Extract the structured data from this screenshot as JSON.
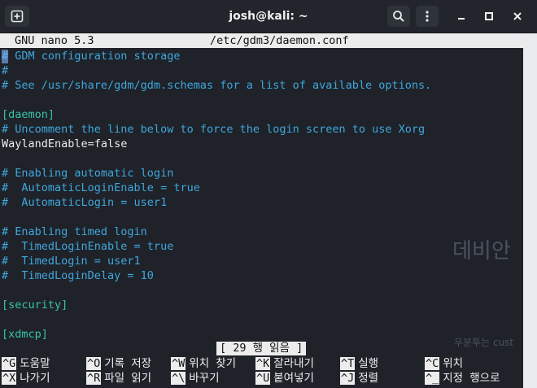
{
  "window": {
    "title": "josh@kali: ~"
  },
  "nano": {
    "version": "GNU nano 5.3",
    "filename": "/etc/gdm3/daemon.conf"
  },
  "lines": [
    {
      "text": "# GDM configuration storage",
      "kind": "comment"
    },
    {
      "text": "#",
      "kind": "comment"
    },
    {
      "text": "# See /usr/share/gdm/gdm.schemas for a list of available options.",
      "kind": "comment"
    },
    {
      "text": "",
      "kind": "text"
    },
    {
      "text": "[daemon]",
      "kind": "section"
    },
    {
      "text": "# Uncomment the line below to force the login screen to use Xorg",
      "kind": "comment"
    },
    {
      "text": "WaylandEnable=false",
      "kind": "text"
    },
    {
      "text": "",
      "kind": "text"
    },
    {
      "text": "# Enabling automatic login",
      "kind": "comment"
    },
    {
      "text": "#  AutomaticLoginEnable = true",
      "kind": "comment"
    },
    {
      "text": "#  AutomaticLogin = user1",
      "kind": "comment"
    },
    {
      "text": "",
      "kind": "text"
    },
    {
      "text": "# Enabling timed login",
      "kind": "comment"
    },
    {
      "text": "#  TimedLoginEnable = true",
      "kind": "comment"
    },
    {
      "text": "#  TimedLogin = user1",
      "kind": "comment"
    },
    {
      "text": "#  TimedLoginDelay = 10",
      "kind": "comment"
    },
    {
      "text": "",
      "kind": "text"
    },
    {
      "text": "[security]",
      "kind": "section"
    },
    {
      "text": "",
      "kind": "text"
    },
    {
      "text": "[xdmcp]",
      "kind": "section"
    }
  ],
  "status_message": "[ 29 행 읽음 ]",
  "shortcuts_row1": [
    {
      "key": "^G",
      "label": "도움말"
    },
    {
      "key": "^O",
      "label": "기록 저장"
    },
    {
      "key": "^W",
      "label": "위치 찾기"
    },
    {
      "key": "^K",
      "label": "잘라내기"
    },
    {
      "key": "^T",
      "label": "실행"
    },
    {
      "key": "^C",
      "label": "위치"
    }
  ],
  "shortcuts_row2": [
    {
      "key": "^X",
      "label": "나가기"
    },
    {
      "key": "^R",
      "label": "파일 읽기"
    },
    {
      "key": "^\\",
      "label": "바꾸기"
    },
    {
      "key": "^U",
      "label": "붙여넣기"
    },
    {
      "key": "^J",
      "label": "정렬"
    },
    {
      "key": "^_",
      "label": "지정 행으로"
    }
  ],
  "background": {
    "text_large": "데비안",
    "text_small": "우분투는 cust"
  },
  "colors": {
    "comment": "#3fa7dc",
    "section": "#37c4a8",
    "text": "#ececec",
    "terminal_bg": "#1f2229"
  }
}
